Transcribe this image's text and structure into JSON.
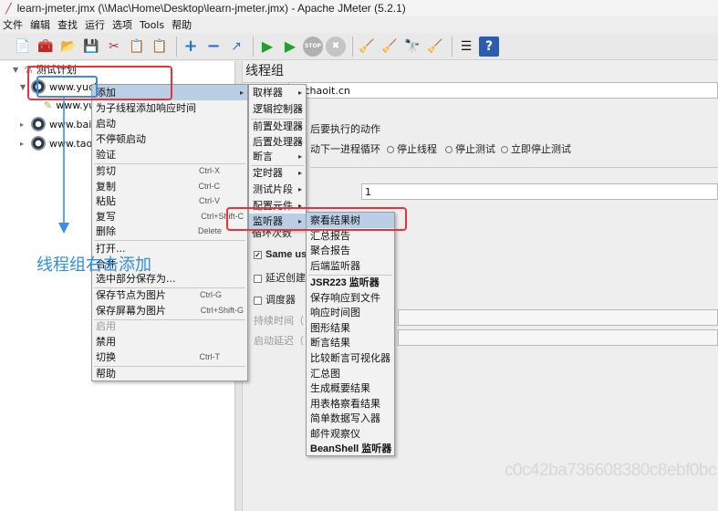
{
  "window": {
    "title": "learn-jmeter.jmx (\\\\Mac\\Home\\Desktop\\learn-jmeter.jmx) - Apache JMeter (5.2.1)"
  },
  "menubar": [
    "文件",
    "编辑",
    "查找",
    "运行",
    "选项",
    "Tools",
    "帮助"
  ],
  "toolbar": {
    "icons": [
      "new-icon",
      "templates-icon",
      "open-icon",
      "save-icon",
      "cut-icon",
      "copy-icon",
      "paste-icon",
      "expand-icon",
      "collapse-icon",
      "toggle-icon",
      "start-icon",
      "start-no-pause-icon",
      "stop-icon",
      "shutdown-icon",
      "clear-icon",
      "clear-all-icon",
      "search-icon",
      "reset-search-icon",
      "function-helper-icon",
      "help-icon"
    ],
    "glyphs": [
      "📄",
      "🧰",
      "📂",
      "💾",
      "✂",
      "📋",
      "📋",
      "+",
      "−",
      "↗",
      "▶",
      "▶",
      "STOP",
      "✖",
      "🧹",
      "🧹",
      "🔭",
      "🧹",
      "☰",
      "?"
    ],
    "colors": {
      "start": "#1fa12a",
      "stop": "#9a9a9a"
    }
  },
  "tree": {
    "test_plan": "测试计划",
    "thread_group": "www.yuch",
    "child_sampler": "www.yu",
    "item_baidu": "www.baid",
    "item_taobao": "www.taob"
  },
  "right_panel": {
    "title": "线程组",
    "name_value": "yuchaoit.cn",
    "action_label": "后要执行的动作",
    "opt_next_loop": "动下一进程循环",
    "opt_stop_thread": "停止线程",
    "opt_stop_test": "停止测试",
    "opt_stop_now": "立即停止测试",
    "field_value_1": "1",
    "loop_label": "循环次数",
    "same_user_label": "Same use",
    "delay_label": "延迟创建线",
    "scheduler_label": "调度器",
    "duration_label": "持续时间（",
    "startup_delay_label": "启动延迟（"
  },
  "context_menu": {
    "items": [
      {
        "label": "添加",
        "arrow": true
      },
      {
        "label": "为子线程添加响应时间"
      },
      {
        "label": "启动"
      },
      {
        "label": "不停顿启动"
      },
      {
        "label": "验证"
      },
      {
        "label": "剪切",
        "shortcut": "Ctrl-X"
      },
      {
        "label": "复制",
        "shortcut": "Ctrl-C"
      },
      {
        "label": "粘贴",
        "shortcut": "Ctrl-V"
      },
      {
        "label": "复写",
        "shortcut": "Ctrl+Shift-C"
      },
      {
        "label": "删除",
        "shortcut": "Delete"
      },
      {
        "label": "打开..."
      },
      {
        "label": "合并"
      },
      {
        "label": "选中部分保存为..."
      },
      {
        "label": "保存节点为图片",
        "shortcut": "Ctrl-G"
      },
      {
        "label": "保存屏幕为图片",
        "shortcut": "Ctrl+Shift-G"
      },
      {
        "label": "启用"
      },
      {
        "label": "禁用"
      },
      {
        "label": "切换",
        "shortcut": "Ctrl-T"
      },
      {
        "label": "帮助"
      }
    ]
  },
  "submenu_add": {
    "items": [
      "取样器",
      "逻辑控制器",
      "前置处理器",
      "后置处理器",
      "断言",
      "定时器",
      "测试片段",
      "配置元件",
      "监听器"
    ]
  },
  "submenu_listener": {
    "items": [
      "察看结果树",
      "汇总报告",
      "聚合报告",
      "后端监听器",
      "JSR223 监听器",
      "保存响应到文件",
      "响应时间图",
      "图形结果",
      "断言结果",
      "比较断言可视化器",
      "汇总图",
      "生成概要结果",
      "用表格察看结果",
      "简单数据写入器",
      "邮件观察仪",
      "BeanShell 监听器"
    ]
  },
  "annotation": {
    "text": "线程组右击添加"
  },
  "watermark": "c0c42ba736608380c8ebf0bc",
  "colors": {
    "highlight": "#b8cfe5",
    "red_box": "#e8323c",
    "blue_annotation": "#2d8fe6"
  }
}
